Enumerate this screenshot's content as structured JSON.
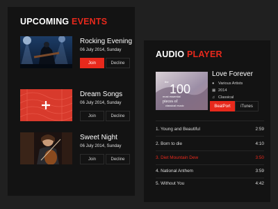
{
  "events": {
    "title_white": "UPCOMING",
    "title_accent": "EVENTS",
    "items": [
      {
        "title": "Rocking Evening",
        "date": "06 July 2014, Sunday",
        "join": "Join",
        "decline": "Decline",
        "join_active": true
      },
      {
        "title": "Dream Songs",
        "date": "06 July 2014, Sunday",
        "join": "Join",
        "decline": "Decline",
        "join_active": false
      },
      {
        "title": "Sweet Night",
        "date": "06 July 2014, Sunday",
        "join": "Join",
        "decline": "Decline",
        "join_active": false
      }
    ]
  },
  "player": {
    "title_white": "AUDIO",
    "title_accent": "PLAYER",
    "song": "Love Forever",
    "artist": "Various Artists",
    "year": "2014",
    "genre": "Classical",
    "album_art": {
      "big_number": "100",
      "lines": [
        "the",
        "most essential",
        "pieces of",
        "classical music"
      ]
    },
    "stores": [
      "BeatPort",
      "iTunes"
    ],
    "tracks": [
      {
        "name": "1. Young and Beautiful",
        "duration": "2:59"
      },
      {
        "name": "2. Born to die",
        "duration": "4:10"
      },
      {
        "name": "3. Diet Mountain Dew",
        "duration": "3:50",
        "active": true
      },
      {
        "name": "4. National Anthem",
        "duration": "3:59"
      },
      {
        "name": "5. Without You",
        "duration": "4:42"
      }
    ]
  },
  "colors": {
    "accent": "#e8291c",
    "background": "#202020",
    "panel": "#131313"
  }
}
